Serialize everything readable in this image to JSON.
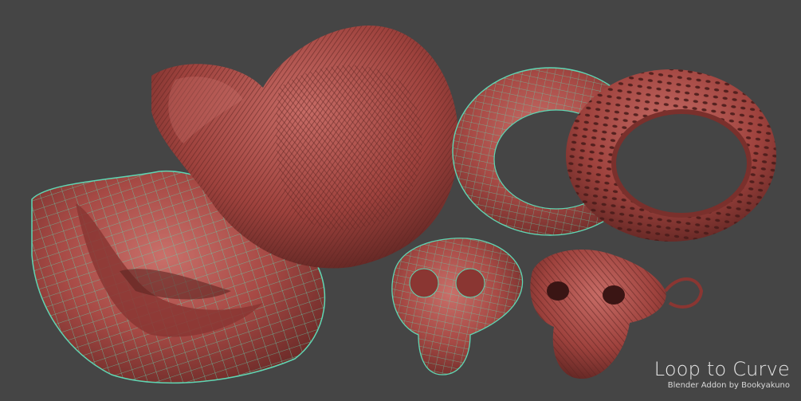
{
  "caption": {
    "title": "Loop to Curve",
    "subtitle": "Blender Addon by Bookyakuno"
  },
  "colors": {
    "background": "#454545",
    "clay": "#a74a45",
    "clay_dark": "#6e2c29",
    "clay_light": "#c9706a",
    "wire": "#5fd6b3"
  },
  "objects": [
    {
      "name": "wireframe-tube-shape",
      "style": "wireframe"
    },
    {
      "name": "curve-tube-shape",
      "style": "curves"
    },
    {
      "name": "wireframe-torus",
      "style": "wireframe"
    },
    {
      "name": "curve-torus",
      "style": "curves"
    },
    {
      "name": "wireframe-monkey-head",
      "style": "wireframe"
    },
    {
      "name": "curve-monkey-head",
      "style": "curves"
    }
  ]
}
